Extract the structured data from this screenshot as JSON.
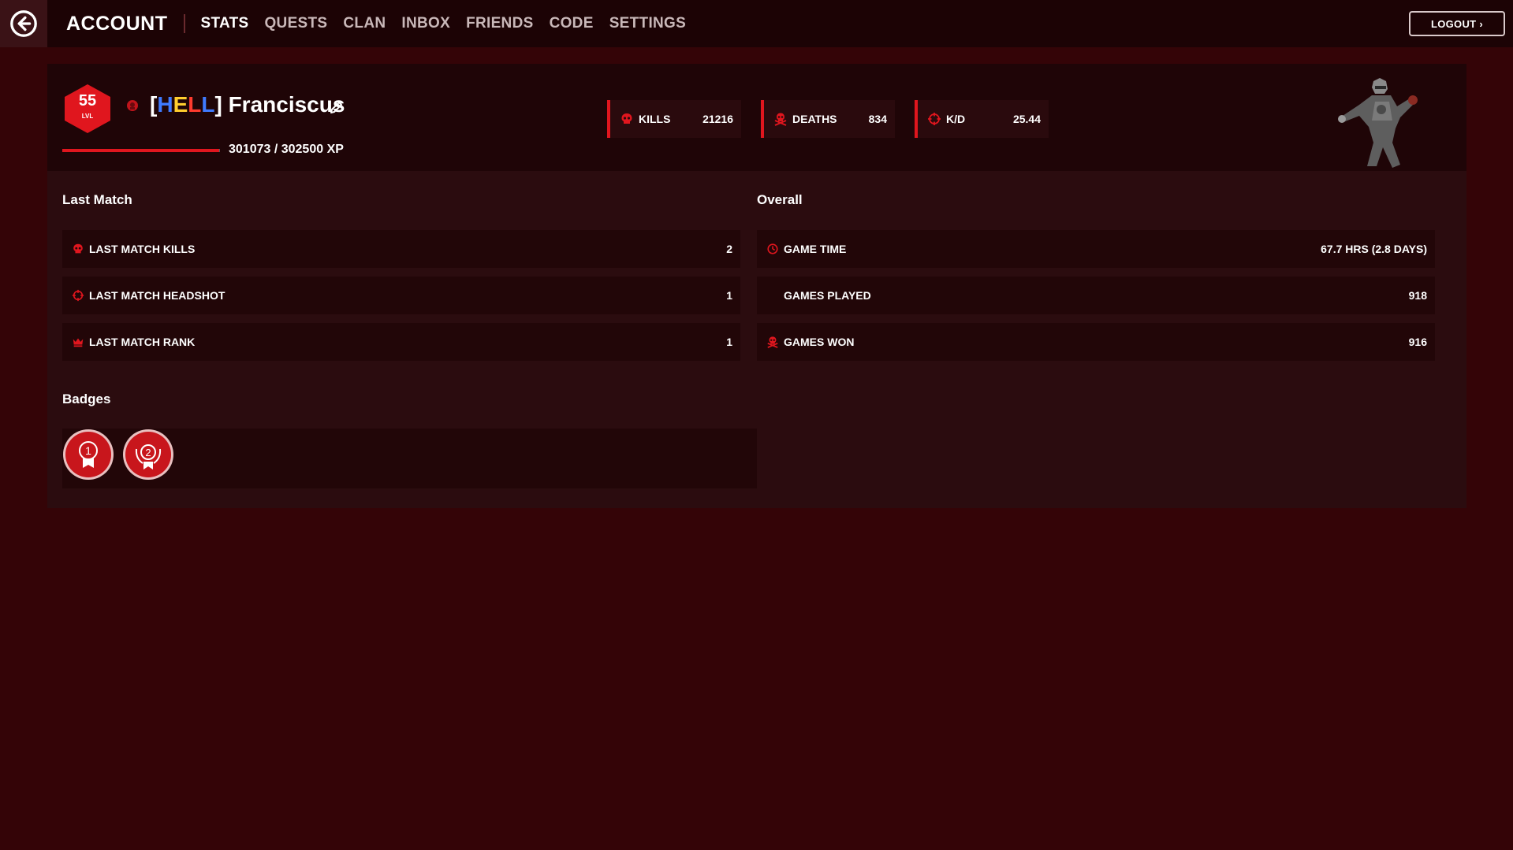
{
  "nav": {
    "title": "ACCOUNT",
    "tabs": [
      "STATS",
      "QUESTS",
      "CLAN",
      "INBOX",
      "FRIENDS",
      "CODE",
      "SETTINGS"
    ],
    "active_tab": "STATS",
    "logout_label": "LOGOUT",
    "back_icon": "arrow-left-circle-icon"
  },
  "profile": {
    "level": "55",
    "level_label": "LVL",
    "clan_tag_open": "[",
    "clan_tag_letters": [
      "H",
      "E",
      "L",
      "L"
    ],
    "clan_tag_close": "]",
    "name": "Franciscus",
    "xp_text": "301073 / 302500 XP",
    "xp_current": 301073,
    "xp_max": 302500
  },
  "header_stats": [
    {
      "icon": "skull-icon",
      "label": "KILLS",
      "value": "21216"
    },
    {
      "icon": "skull-crossbones-icon",
      "label": "DEATHS",
      "value": "834"
    },
    {
      "icon": "crosshair-icon",
      "label": "K/D",
      "value": "25.44"
    }
  ],
  "last_match": {
    "title": "Last Match",
    "rows": [
      {
        "icon": "skull-icon",
        "label": "LAST MATCH KILLS",
        "value": "2"
      },
      {
        "icon": "crosshair-icon",
        "label": "LAST MATCH HEADSHOT",
        "value": "1"
      },
      {
        "icon": "crown-icon",
        "label": "LAST MATCH RANK",
        "value": "1"
      }
    ]
  },
  "overall": {
    "title": "Overall",
    "rows": [
      {
        "icon": "clock-icon",
        "label": "GAME TIME",
        "value": "67.7 HRS (2.8 DAYS)"
      },
      {
        "icon": "",
        "label": "GAMES PLAYED",
        "value": "918"
      },
      {
        "icon": "skull-crossbones-icon",
        "label": "GAMES WON",
        "value": "916"
      }
    ]
  },
  "badges": {
    "title": "Badges",
    "items": [
      {
        "icon": "first-place-medal-icon",
        "number": "1"
      },
      {
        "icon": "second-place-laurel-medal-icon",
        "number": "2"
      }
    ]
  },
  "colors": {
    "accent": "#e0161e",
    "background": "#340407",
    "topbar": "#1c0305"
  }
}
